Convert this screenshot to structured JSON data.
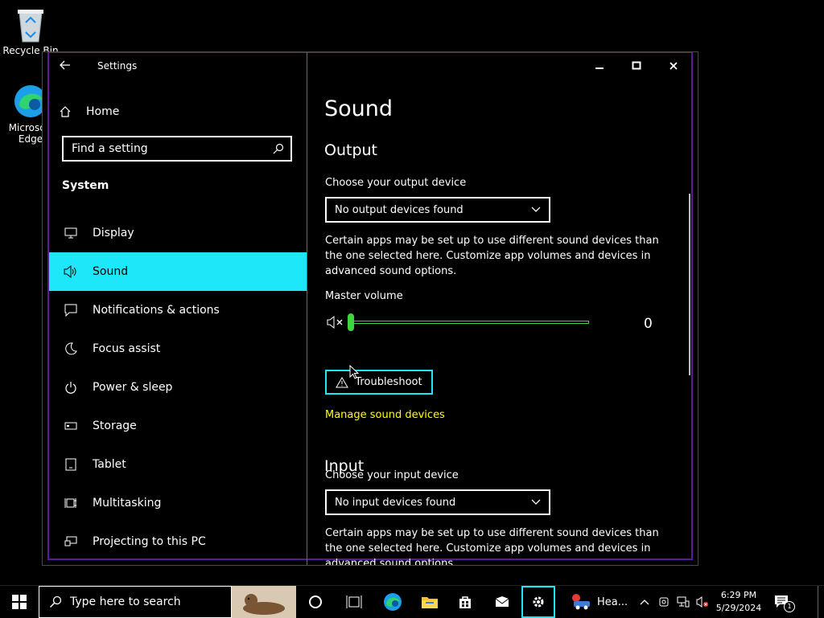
{
  "desktop": {
    "icons": [
      {
        "label": "Recycle Bin",
        "icon": "recycle-bin-icon"
      },
      {
        "label": "Microsoft Edge",
        "icon": "edge-icon"
      }
    ]
  },
  "window": {
    "title": "Settings",
    "controls": [
      "minimize-icon",
      "maximize-icon",
      "close-icon"
    ]
  },
  "sidebar": {
    "home_label": "Home",
    "search_placeholder": "Find a setting",
    "section": "System",
    "items": [
      {
        "label": "Display",
        "icon": "display-icon",
        "active": false
      },
      {
        "label": "Sound",
        "icon": "speaker-icon",
        "active": true
      },
      {
        "label": "Notifications & actions",
        "icon": "notification-icon",
        "active": false
      },
      {
        "label": "Focus assist",
        "icon": "moon-icon",
        "active": false
      },
      {
        "label": "Power & sleep",
        "icon": "power-icon",
        "active": false
      },
      {
        "label": "Storage",
        "icon": "storage-icon",
        "active": false
      },
      {
        "label": "Tablet",
        "icon": "tablet-icon",
        "active": false
      },
      {
        "label": "Multitasking",
        "icon": "multitasking-icon",
        "active": false
      },
      {
        "label": "Projecting to this PC",
        "icon": "projector-icon",
        "active": false
      }
    ]
  },
  "main": {
    "title": "Sound",
    "output": {
      "heading": "Output",
      "device_label": "Choose your output device",
      "device_value": "No output devices found",
      "description": "Certain apps may be set up to use different sound devices than the one selected here. Customize app volumes and devices in advanced sound options.",
      "master_volume_label": "Master volume",
      "volume_value": "0",
      "volume_level": 0,
      "troubleshoot_label": "Troubleshoot",
      "manage_link": "Manage sound devices"
    },
    "input": {
      "heading": "Input",
      "device_label": "Choose your input device",
      "device_value": "No input devices found",
      "description": "Certain apps may be set up to use different sound devices than the one selected here. Customize app volumes and devices in advanced sound options."
    }
  },
  "taskbar": {
    "search_placeholder": "Type here to search",
    "app_label": "Hea...",
    "time": "6:29 PM",
    "date": "5/29/2024",
    "notification_count": "1"
  },
  "colors": {
    "accent": "#1de7f9",
    "link": "#ffff00",
    "slider": "#3ed63e",
    "window_border": "#5b1a9a"
  }
}
